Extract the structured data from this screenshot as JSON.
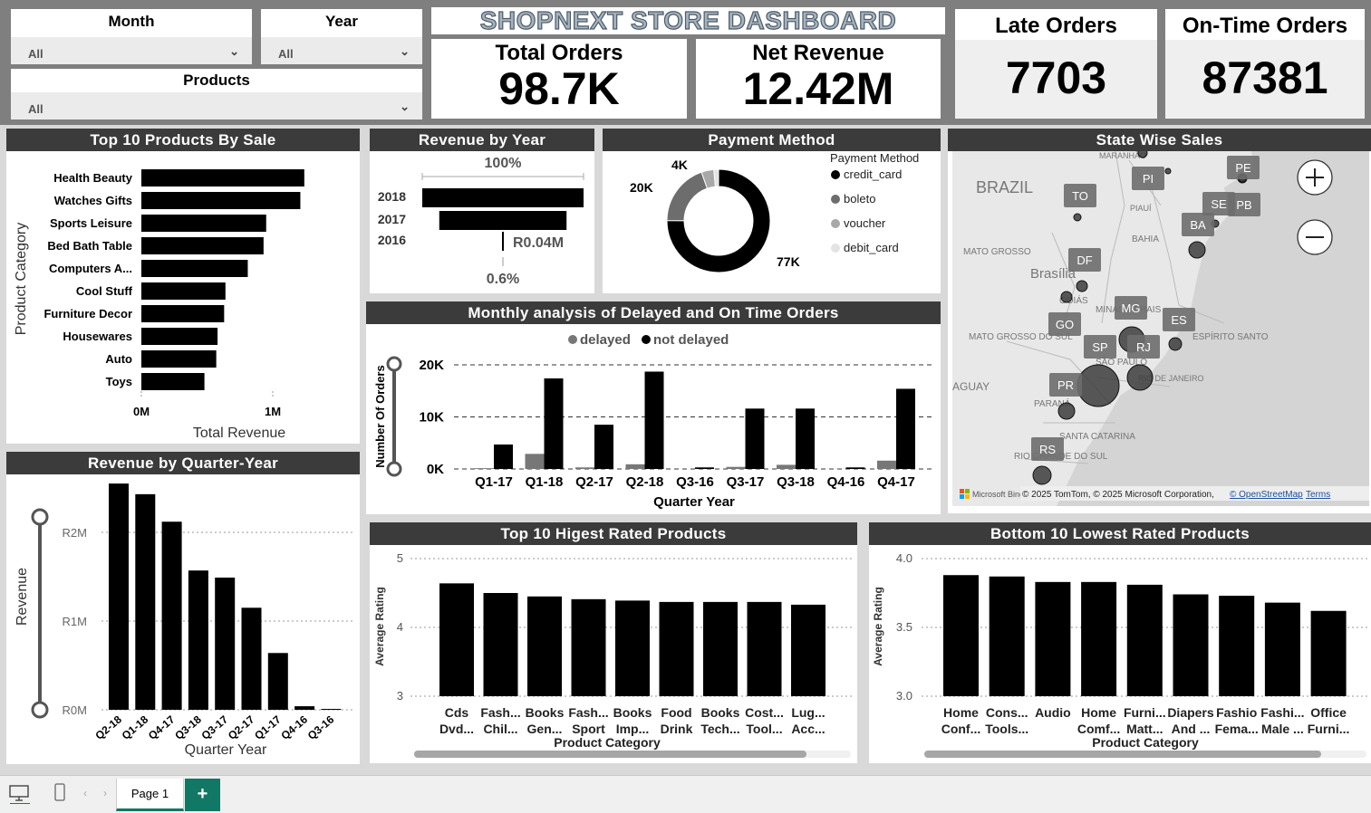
{
  "filters": {
    "month": {
      "label": "Month",
      "value": "All"
    },
    "year": {
      "label": "Year",
      "value": "All"
    },
    "products": {
      "label": "Products",
      "value": "All"
    }
  },
  "dashboard_title": "SHOPNEXT STORE DASHBOARD",
  "kpis": {
    "total_orders": {
      "label": "Total Orders",
      "value": "98.7K"
    },
    "net_revenue": {
      "label": "Net Revenue",
      "value": "12.42M"
    },
    "late_orders": {
      "label": "Late Orders",
      "value": "7703"
    },
    "on_time_orders": {
      "label": "On-Time Orders",
      "value": "87381"
    }
  },
  "colors": {
    "bar": "#000000",
    "delayed": "#777777",
    "header": "#3b3b3b",
    "band": "#7f7f7f"
  },
  "top_products": {
    "title": "Top 10 Products By Sale",
    "chart_data": {
      "type": "bar",
      "orientation": "horizontal",
      "categories": [
        "Health Beauty",
        "Watches Gifts",
        "Sports Leisure",
        "Bed Bath Table",
        "Computers A...",
        "Cool Stuff",
        "Furniture Decor",
        "Housewares",
        "Auto",
        "Toys"
      ],
      "values": [
        1240000,
        1210000,
        950000,
        930000,
        810000,
        640000,
        630000,
        580000,
        570000,
        480000
      ],
      "xlabel": "Total Revenue",
      "ylabel": "Product Category",
      "xticks": [
        "0M",
        "1M"
      ],
      "xlim": [
        0,
        1400000
      ]
    }
  },
  "revenue_by_year": {
    "title": "Revenue by Year",
    "chart_data": {
      "type": "funnel",
      "categories": [
        "2018",
        "2017",
        "2016"
      ],
      "values": [
        6920000,
        5460000,
        40000
      ],
      "top_label": "100%",
      "bottom_label": "0.6%",
      "value_label": "R0.04M"
    }
  },
  "payment_method": {
    "title": "Payment Method",
    "legend_title": "Payment Method",
    "chart_data": {
      "type": "pie",
      "hole": true,
      "categories": [
        "credit_card",
        "boleto",
        "voucher",
        "debit_card"
      ],
      "values": [
        77000,
        20000,
        4000,
        1500
      ],
      "colors": [
        "#000000",
        "#6d6d6d",
        "#a8a8a8",
        "#e3e3e3"
      ],
      "data_labels": [
        "77K",
        "20K",
        "4K"
      ]
    }
  },
  "state_sales": {
    "title": "State Wise Sales",
    "map_labels": [
      "BRAZIL",
      "MATO GROSSO",
      "Brasília",
      "BAHIA",
      "MATO GROSSO DO SUL",
      "MINAS GERAIS",
      "SÃO PAULO",
      "PARANÁ",
      "ESPÍRITO SANTO",
      "RIO DE JANEIRO",
      "SANTA CATARINA",
      "RIO GRANDE DO SUL",
      "MARANHÃO",
      "PIAUÍ",
      "GOIÁS",
      "AGUAY"
    ],
    "states": [
      "PE",
      "PI",
      "TO",
      "SE",
      "PB",
      "BA",
      "DF",
      "MG",
      "ES",
      "GO",
      "SP",
      "RJ",
      "PR",
      "RS"
    ],
    "attribution": "© 2025 TomTom, © 2025 Microsoft Corporation,",
    "osm_link": "© OpenStreetMap",
    "terms_link": "Terms",
    "bing_label": "Microsoft Bing"
  },
  "monthly_orders": {
    "title": "Monthly analysis of Delayed and On Time Orders",
    "chart_data": {
      "type": "bar",
      "categories": [
        "Q1-17",
        "Q1-18",
        "Q2-17",
        "Q2-18",
        "Q3-16",
        "Q3-17",
        "Q3-18",
        "Q4-16",
        "Q4-17"
      ],
      "series": [
        {
          "name": "delayed",
          "values": [
            150,
            2900,
            300,
            900,
            10,
            400,
            800,
            20,
            1600
          ]
        },
        {
          "name": "not delayed",
          "values": [
            4700,
            17400,
            8500,
            18700,
            300,
            11600,
            11600,
            300,
            15400
          ]
        }
      ],
      "xlabel": "Quarter Year",
      "ylabel": "Number Of Orders",
      "yticks": [
        "0K",
        "10K",
        "20K"
      ],
      "ylim": [
        0,
        20000
      ],
      "grid": true,
      "legend": "top"
    }
  },
  "revenue_by_quarter": {
    "title": "Revenue by Quarter-Year",
    "chart_data": {
      "type": "bar",
      "categories": [
        "Q2-18",
        "Q1-18",
        "Q4-17",
        "Q3-18",
        "Q3-17",
        "Q2-17",
        "Q1-17",
        "Q4-16",
        "Q3-16"
      ],
      "values": [
        2550000,
        2430000,
        2120000,
        1570000,
        1490000,
        1150000,
        640000,
        40000,
        10000
      ],
      "xlabel": "Quarter Year",
      "ylabel": "Revenue",
      "yticks": [
        "R0M",
        "R1M",
        "R2M"
      ],
      "ylim": [
        0,
        2550000
      ],
      "grid": true
    }
  },
  "top_rated": {
    "title": "Top 10 Higest Rated Products",
    "chart_data": {
      "type": "bar",
      "categories": [
        [
          "Cds",
          "Dvd..."
        ],
        [
          "Fash...",
          "Chil..."
        ],
        [
          "Books",
          "Gen..."
        ],
        [
          "Fash...",
          "Sport"
        ],
        [
          "Books",
          "Imp..."
        ],
        [
          "Food",
          "Drink"
        ],
        [
          "Books",
          "Tech..."
        ],
        [
          "Cost...",
          "Tool..."
        ],
        [
          "Lug...",
          "Acc..."
        ]
      ],
      "values": [
        4.64,
        4.5,
        4.45,
        4.41,
        4.39,
        4.37,
        4.37,
        4.37,
        4.33
      ],
      "xlabel": "Product Category",
      "ylabel": "Average Rating",
      "yticks": [
        "3",
        "4",
        "5"
      ],
      "ylim": [
        3,
        5
      ],
      "grid": true
    }
  },
  "bottom_rated": {
    "title": "Bottom 10 Lowest Rated Products",
    "chart_data": {
      "type": "bar",
      "categories": [
        [
          "Home",
          "Conf..."
        ],
        [
          "Cons...",
          "Tools..."
        ],
        [
          "Audio"
        ],
        [
          "Home",
          "Comf..."
        ],
        [
          "Furni...",
          "Matt..."
        ],
        [
          "Diapers",
          "And ..."
        ],
        [
          "Fashio",
          "Fema..."
        ],
        [
          "Fashi...",
          "Male ..."
        ],
        [
          "Office",
          "Furni..."
        ]
      ],
      "values": [
        3.88,
        3.87,
        3.83,
        3.83,
        3.81,
        3.74,
        3.73,
        3.68,
        3.62
      ],
      "xlabel": "Product Category",
      "ylabel": "Average Rating",
      "yticks": [
        "3.0",
        "3.5",
        "4.0"
      ],
      "ylim": [
        3.0,
        4.0
      ],
      "grid": true
    }
  },
  "tabs": {
    "page_label": "Page 1",
    "add_label": "+"
  }
}
